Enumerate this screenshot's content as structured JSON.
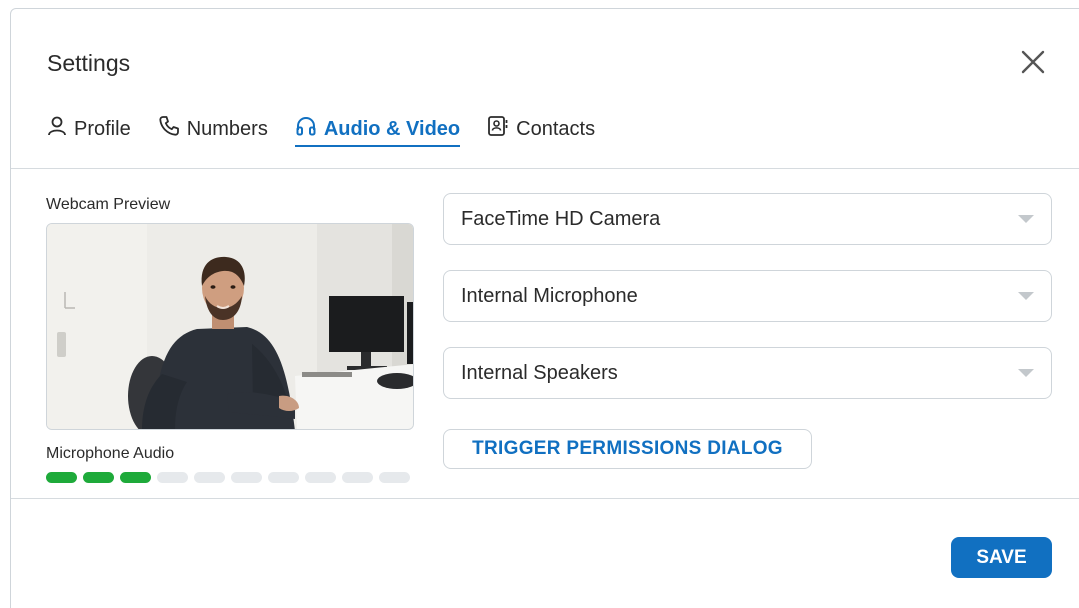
{
  "dialog": {
    "title": "Settings"
  },
  "tabs": [
    {
      "label": "Profile",
      "icon": "person-icon",
      "active": false
    },
    {
      "label": "Numbers",
      "icon": "phone-icon",
      "active": false
    },
    {
      "label": "Audio & Video",
      "icon": "headphones-icon",
      "active": true
    },
    {
      "label": "Contacts",
      "icon": "contact-book-icon",
      "active": false
    }
  ],
  "webcam": {
    "label": "Webcam Preview"
  },
  "microphone": {
    "label": "Microphone Audio",
    "level_segments_active": 3,
    "level_segments_total": 10
  },
  "devices": {
    "camera": "FaceTime HD Camera",
    "microphone": "Internal Microphone",
    "speakers": "Internal Speakers"
  },
  "actions": {
    "trigger_permissions": "TRIGGER PERMISSIONS DIALOG",
    "save": "SAVE"
  },
  "colors": {
    "accent": "#1170c1",
    "meter_on": "#1eaa3a",
    "meter_off": "#e6e9ec"
  }
}
